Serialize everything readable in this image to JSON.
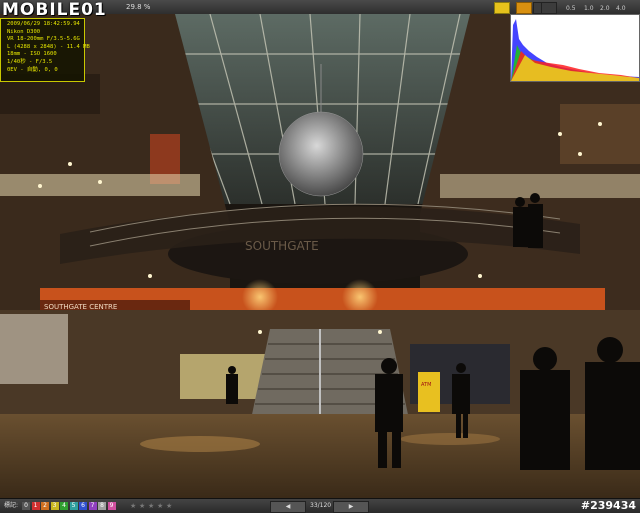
{
  "app": {
    "logo_text": "MOBILE01",
    "zoom_label": "29.8 %"
  },
  "toolbar": {
    "right_labels": [
      "0.5",
      "1.0",
      "2.0",
      "4.0"
    ]
  },
  "exif": {
    "lines": [
      "2009/06/29 18:42:59.94",
      "Nikon D300",
      "VR 18-200mm F/3.5-5.6G",
      "L (4288 x 2848) - 11.4 MB",
      "18mm - ISO 1600",
      "1/40秒 - F/3.5",
      "0EV - 自動, 0, 0"
    ]
  },
  "photo": {
    "signage": "SOUTHGATE",
    "left_sign": "SOUTHGATE CENTRE",
    "atm_sign": "ATM"
  },
  "bottombar": {
    "label_text": "標記:",
    "color_labels": [
      "0",
      "1",
      "2",
      "3",
      "4",
      "5",
      "6",
      "7",
      "8",
      "9"
    ],
    "label_colors": [
      "#555555",
      "#d03030",
      "#d07020",
      "#c8b820",
      "#30a030",
      "#2fa0a0",
      "#3050d0",
      "#9040c0",
      "#a0a0a0",
      "#d050a0"
    ],
    "stars": [
      "★",
      "★",
      "★",
      "★",
      "★"
    ],
    "prev_label": "◀",
    "next_label": "▶",
    "page_counter": "33/120",
    "image_id": "#239434"
  }
}
